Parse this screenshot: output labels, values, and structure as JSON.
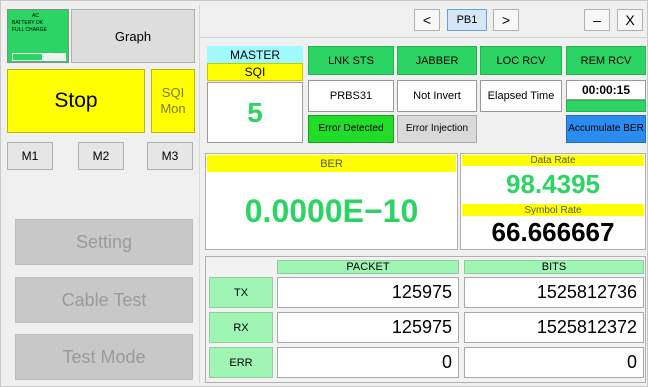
{
  "status_box": {
    "lines": [
      "AC",
      "BATTERY OK",
      "FULL CHARGE"
    ],
    "battery_level": 0.55,
    "dots": "----"
  },
  "left": {
    "graph": "Graph",
    "stop": "Stop",
    "sqi_mon_line1": "SQI",
    "sqi_mon_line2": "Mon",
    "m1": "M1",
    "m2": "M2",
    "m3": "M3",
    "setting": "Setting",
    "cable_test": "Cable Test",
    "test_mode": "Test Mode"
  },
  "top": {
    "prev": "<",
    "port": "PB1",
    "next": ">",
    "minimize": "–",
    "close": "X"
  },
  "master": {
    "label": "MASTER",
    "sqi_label": "SQI",
    "sqi_value": "5"
  },
  "status_headers": {
    "lnk_sts": "LNK STS",
    "jabber": "JABBER",
    "loc_rcv": "LOC RCV",
    "rem_rcv": "REM RCV"
  },
  "info": {
    "pattern": "PRBS31",
    "invert": "Not Invert",
    "elapsed_label": "Elapsed Time",
    "elapsed_value": "00:00:15"
  },
  "error_buttons": {
    "detected": "Error Detected",
    "injection": "Error Injection",
    "accumulate": "Accumulate BER"
  },
  "ber": {
    "label": "BER",
    "value": "0.0000E−10"
  },
  "rates": {
    "data_rate_label": "Data Rate",
    "data_rate_value": "98.4395",
    "symbol_rate_label": "Symbol Rate",
    "symbol_rate_value": "66.666667"
  },
  "counters": {
    "packet_header": "PACKET",
    "bits_header": "BITS",
    "rows": [
      {
        "label": "TX",
        "packet": "125975",
        "bits": "1525812736"
      },
      {
        "label": "RX",
        "packet": "125975",
        "bits": "1525812372"
      },
      {
        "label": "ERR",
        "packet": "0",
        "bits": "0"
      }
    ]
  }
}
